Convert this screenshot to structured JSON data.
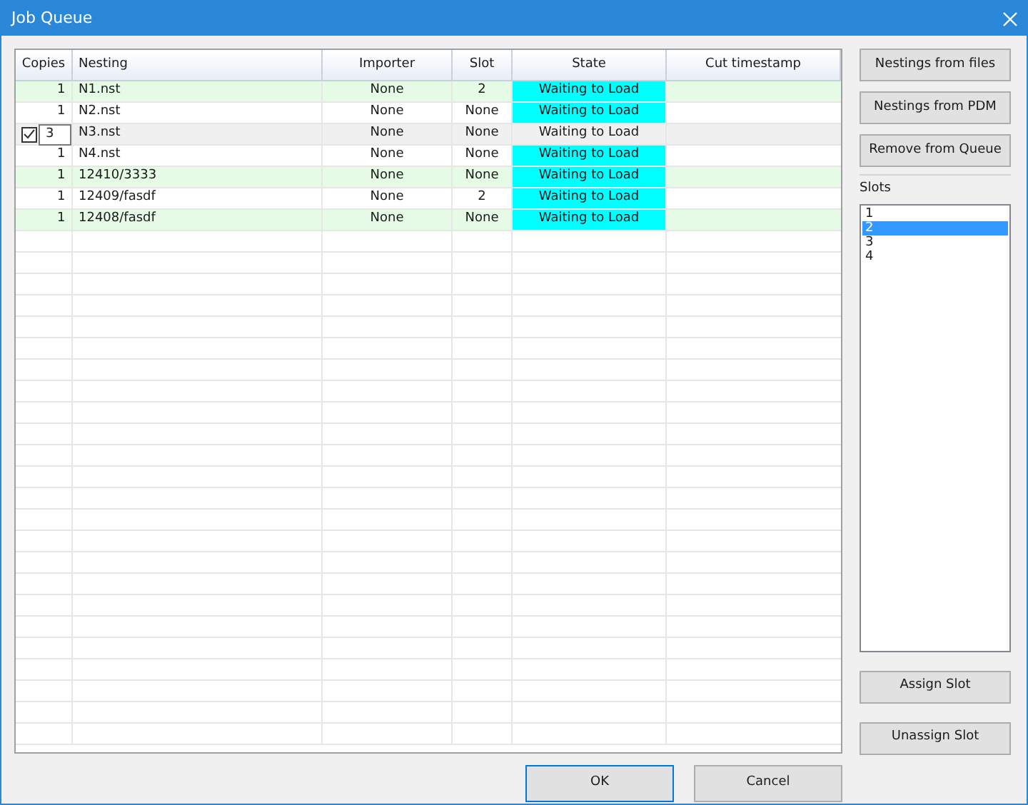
{
  "window": {
    "title": "Job Queue"
  },
  "table": {
    "columns": [
      "Copies",
      "Nesting",
      "Importer",
      "Slot",
      "State",
      "Cut timestamp"
    ],
    "rows": [
      {
        "copies": "1",
        "nesting": "N1.nst",
        "importer": "None",
        "slot": "2",
        "state": "Waiting to Load",
        "highlighted": true,
        "shaded": true,
        "editing": false
      },
      {
        "copies": "1",
        "nesting": "N2.nst",
        "importer": "None",
        "slot": "None",
        "state": "Waiting to Load",
        "highlighted": true,
        "shaded": false,
        "editing": false
      },
      {
        "copies": "3",
        "nesting": "N3.nst",
        "importer": "None",
        "slot": "None",
        "state": "Waiting to Load",
        "highlighted": false,
        "editing": true,
        "checked": true
      },
      {
        "copies": "1",
        "nesting": "N4.nst",
        "importer": "None",
        "slot": "None",
        "state": "Waiting to Load",
        "highlighted": true,
        "shaded": false,
        "editing": false
      },
      {
        "copies": "1",
        "nesting": "12410/3333",
        "importer": "None",
        "slot": "None",
        "state": "Waiting to Load",
        "highlighted": true,
        "shaded": true,
        "editing": false
      },
      {
        "copies": "1",
        "nesting": "12409/fasdf",
        "importer": "None",
        "slot": "2",
        "state": "Waiting to Load",
        "highlighted": true,
        "shaded": false,
        "editing": false
      },
      {
        "copies": "1",
        "nesting": "12408/fasdf",
        "importer": "None",
        "slot": "None",
        "state": "Waiting to Load",
        "highlighted": true,
        "shaded": true,
        "editing": false
      }
    ]
  },
  "side_buttons": [
    "Nestings from files",
    "Nestings from PDM",
    "Remove from Queue"
  ],
  "slots": {
    "label": "Slots",
    "items": [
      {
        "label": "1",
        "selected": false
      },
      {
        "label": "2",
        "selected": true
      },
      {
        "label": "3",
        "selected": false
      },
      {
        "label": "4",
        "selected": false
      }
    ]
  },
  "slot_buttons": [
    "Assign Slot",
    "Unassign Slot"
  ],
  "buttons": [
    {
      "label": "OK",
      "default": true
    },
    {
      "label": "Cancel",
      "default": false
    }
  ]
}
